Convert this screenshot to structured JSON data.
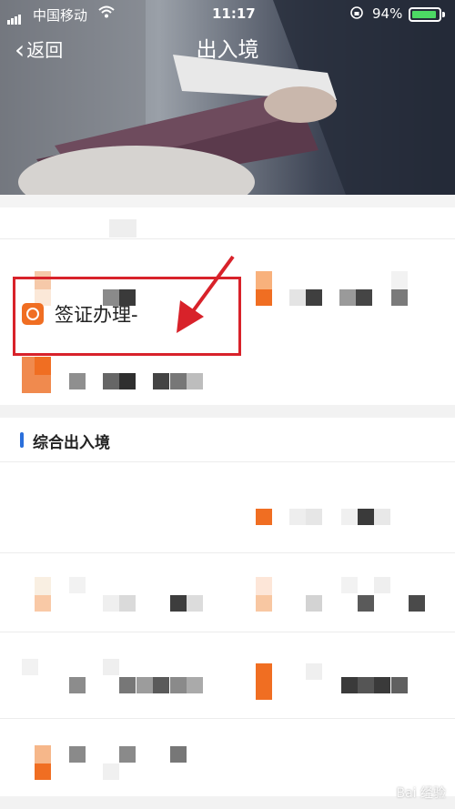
{
  "status_bar": {
    "carrier": "中国移动",
    "time": "11:17",
    "battery_percent": "94%",
    "battery_level": 0.94
  },
  "nav": {
    "back_label": "返回",
    "title": "出入境"
  },
  "section": {
    "title": "综合出入境"
  },
  "visa_item": {
    "label": "签证办理-"
  },
  "watermark": "Bai 经验",
  "colors": {
    "accent_orange": "#f06e22",
    "highlight_red": "#d8222a",
    "section_bar_blue": "#2a6fdb"
  }
}
